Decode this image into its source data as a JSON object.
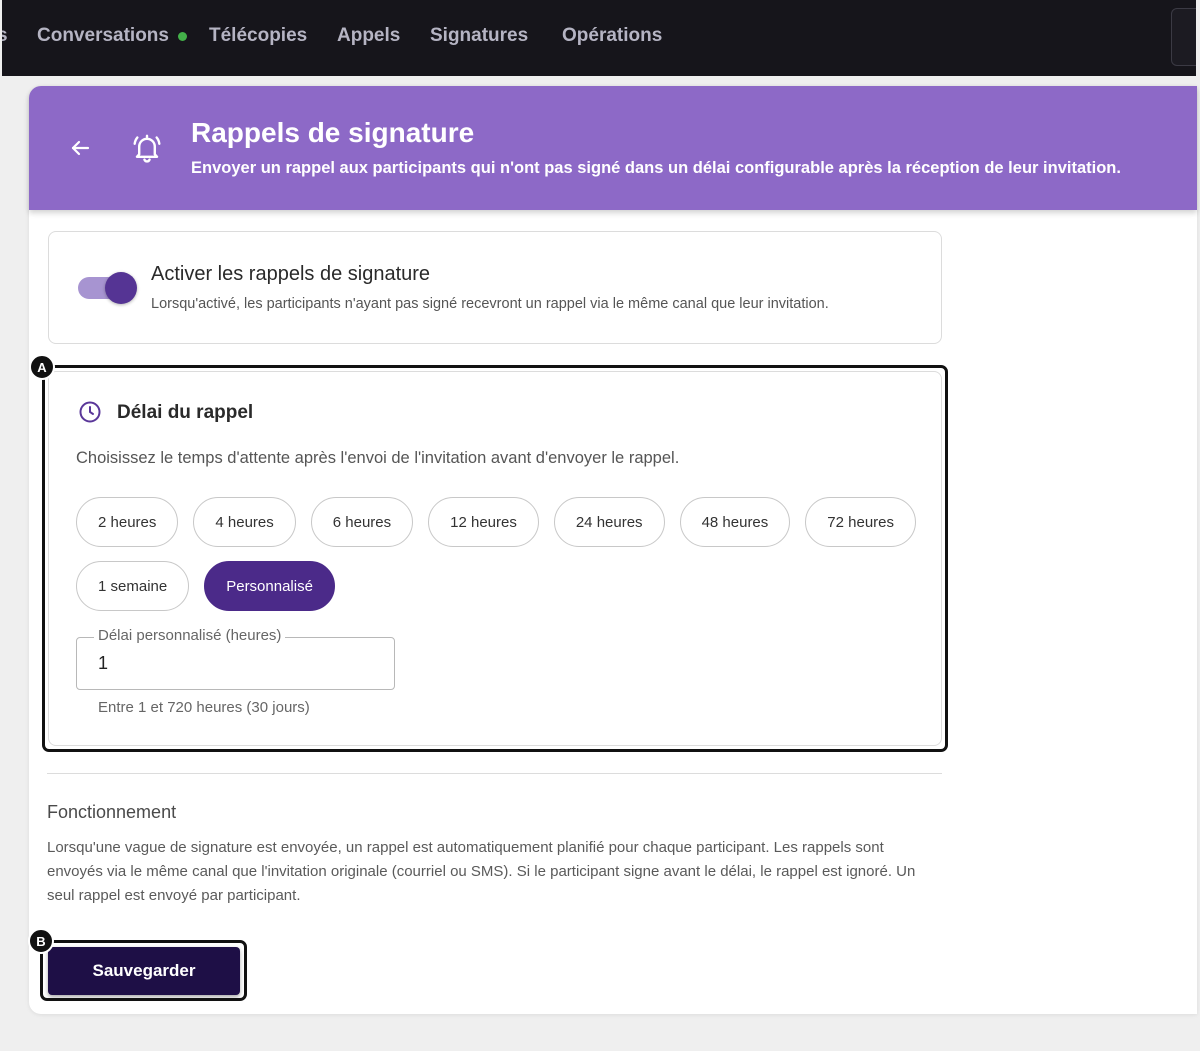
{
  "nav": {
    "partial_item": "s",
    "items": [
      {
        "label": "Conversations"
      },
      {
        "label": "Télécopies"
      },
      {
        "label": "Appels"
      },
      {
        "label": "Signatures"
      },
      {
        "label": "Opérations"
      }
    ]
  },
  "header": {
    "back_icon": "arrow-left-icon",
    "feature_icon": "bell-ringing-icon",
    "title": "Rappels de signature",
    "subtitle": "Envoyer un rappel aux participants qui n'ont pas signé dans un délai configurable après la réception de leur invitation."
  },
  "enable_reminders": {
    "enabled": true,
    "title": "Activer les rappels de signature",
    "description": "Lorsqu'activé, les participants n'ayant pas signé recevront un rappel via le même canal que leur invitation."
  },
  "reminder_delay": {
    "icon": "clock-icon",
    "title": "Délai du rappel",
    "description": "Choisissez le temps d'attente après l'envoi de l'invitation avant d'envoyer le rappel.",
    "options": [
      {
        "label": "2 heures",
        "selected": false
      },
      {
        "label": "4 heures",
        "selected": false
      },
      {
        "label": "6 heures",
        "selected": false
      },
      {
        "label": "12 heures",
        "selected": false
      },
      {
        "label": "24 heures",
        "selected": false
      },
      {
        "label": "48 heures",
        "selected": false
      },
      {
        "label": "72 heures",
        "selected": false
      },
      {
        "label": "1 semaine",
        "selected": false
      },
      {
        "label": "Personnalisé",
        "selected": true
      }
    ],
    "custom_delay": {
      "label": "Délai personnalisé (heures)",
      "value": "1",
      "helper_text": "Entre 1 et 720 heures (30 jours)"
    }
  },
  "how_it_works": {
    "title": "Fonctionnement",
    "lines": [
      "Lorsqu'une vague de signature est envoyée, un rappel est automatiquement planifié pour chaque participant. Les rappels sont",
      "envoyés via le même canal que l'invitation originale (courriel ou SMS). Si le participant signe avant le délai, le rappel est ignoré. Un",
      "seul rappel est envoyé par participant."
    ]
  },
  "actions": {
    "save_label": "Sauvegarder"
  },
  "annotations": {
    "a": "A",
    "b": "B"
  },
  "colors": {
    "nav_background": "#16151b",
    "header_background": "#8d69c7",
    "accent": "#4b2a89",
    "save_button": "#1e0f46",
    "status_dot": "#43b049"
  }
}
